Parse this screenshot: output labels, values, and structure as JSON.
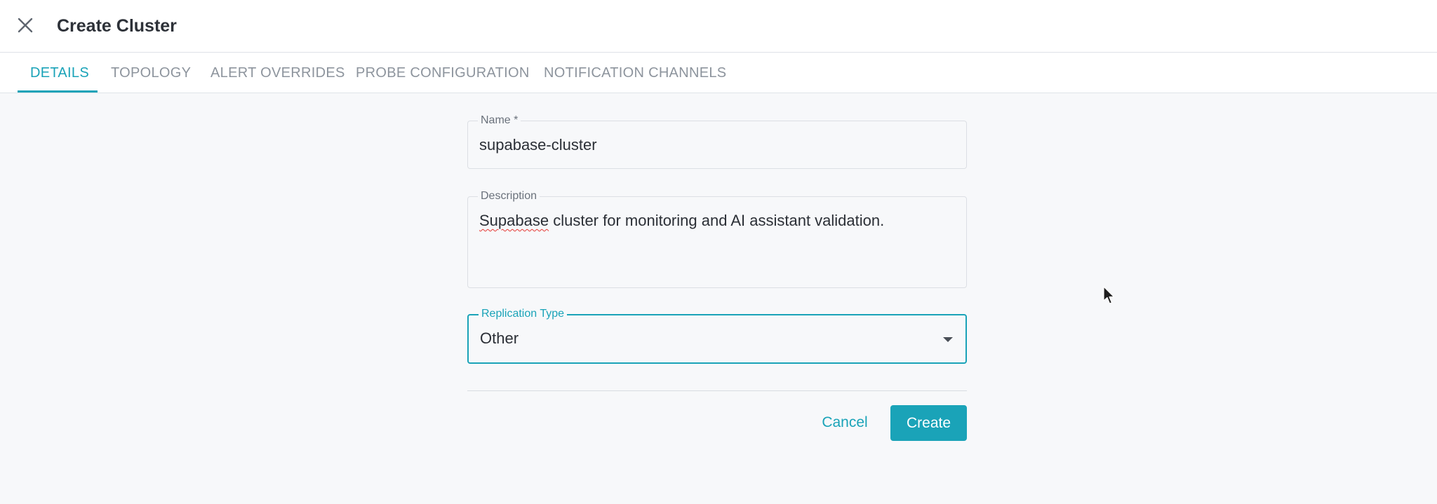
{
  "header": {
    "title": "Create Cluster",
    "close_icon": "close-icon"
  },
  "tabs": [
    {
      "label": "DETAILS",
      "active": true
    },
    {
      "label": "TOPOLOGY",
      "active": false
    },
    {
      "label": "ALERT OVERRIDES",
      "active": false
    },
    {
      "label": "PROBE CONFIGURATION",
      "active": false
    },
    {
      "label": "NOTIFICATION CHANNELS",
      "active": false
    }
  ],
  "form": {
    "name": {
      "label": "Name *",
      "value": "supabase-cluster"
    },
    "description": {
      "label": "Description",
      "value_misspelled": "Supabase",
      "value_rest": " cluster for monitoring and AI assistant validation."
    },
    "replication_type": {
      "label": "Replication Type",
      "value": "Other",
      "icon": "chevron-down-icon"
    }
  },
  "actions": {
    "cancel_label": "Cancel",
    "create_label": "Create"
  },
  "colors": {
    "accent": "#1aa3b8",
    "background": "#f7f8fa",
    "header_bg": "#ffffff"
  }
}
